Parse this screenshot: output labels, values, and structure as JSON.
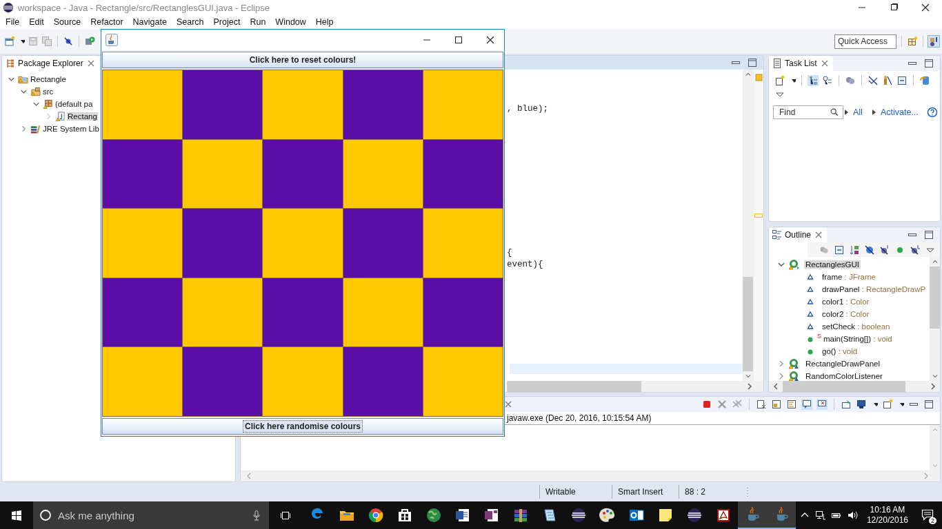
{
  "window": {
    "title": "workspace - Java - Rectangle/src/RectanglesGUI.java - Eclipse"
  },
  "menu": [
    "File",
    "Edit",
    "Source",
    "Refactor",
    "Navigate",
    "Search",
    "Project",
    "Run",
    "Window",
    "Help"
  ],
  "quick_access": {
    "placeholder": "Quick Access"
  },
  "package_explorer": {
    "title": "Package Explorer",
    "tree": [
      {
        "kind": "project",
        "label": "Rectangle",
        "expanded": true,
        "selected": false,
        "children": [
          {
            "kind": "folder",
            "label": "src",
            "expanded": true,
            "selected": false,
            "children": [
              {
                "kind": "package",
                "label": "(default pa",
                "expanded": true,
                "selected": false,
                "children": [
                  {
                    "kind": "file",
                    "label": "Rectang",
                    "expanded": false,
                    "selected": true
                  }
                ]
              }
            ]
          },
          {
            "kind": "library",
            "label": "JRE System Lib",
            "expanded": false,
            "selected": false
          }
        ]
      }
    ]
  },
  "editor": {
    "lines": [
      ", blue);",
      "{",
      "event){"
    ]
  },
  "task_list": {
    "title": "Task List",
    "find": {
      "placeholder": "Find"
    },
    "links": [
      "All",
      "Activate..."
    ]
  },
  "outline": {
    "title": "Outline",
    "tree": [
      {
        "kind": "class",
        "name": "RectanglesGUI",
        "expanded": true,
        "selected": true,
        "children": [
          {
            "kind": "field",
            "name": "frame",
            "type": ": JFrame"
          },
          {
            "kind": "field",
            "name": "drawPanel",
            "type": ": RectangleDrawP"
          },
          {
            "kind": "field",
            "name": "color1",
            "type": ": Color"
          },
          {
            "kind": "field",
            "name": "color2",
            "type": ": Color"
          },
          {
            "kind": "field",
            "name": "setCheck",
            "type": ": boolean"
          },
          {
            "kind": "method",
            "name": "main(String[])",
            "type": ": void",
            "badge": "S"
          },
          {
            "kind": "method",
            "name": "go()",
            "type": ": void"
          }
        ]
      },
      {
        "kind": "inner",
        "name": "RectangleDrawPanel",
        "expanded": false,
        "selected": false
      },
      {
        "kind": "inner",
        "name": "RandomColorListener",
        "expanded": false,
        "selected": false
      }
    ]
  },
  "console": {
    "process": "javaw.exe (Dec 20, 2016, 10:15:54 AM)"
  },
  "status_bar": [
    "Writable",
    "Smart Insert",
    "88 : 2"
  ],
  "java_window": {
    "buttons": [
      {
        "label": "Click here to reset colours!",
        "focused": false
      },
      {
        "label": "Click here randomise colours",
        "focused": true
      }
    ],
    "grid": [
      [
        {
          "color": "#ffc800"
        },
        {
          "color": "#5a0ea5"
        },
        {
          "color": "#ffc800"
        },
        {
          "color": "#5a0ea5"
        },
        {
          "color": "#ffc800"
        }
      ],
      [
        {
          "color": "#5a0ea5"
        },
        {
          "color": "#ffc800"
        },
        {
          "color": "#5a0ea5"
        },
        {
          "color": "#ffc800"
        },
        {
          "color": "#5a0ea5"
        }
      ],
      [
        {
          "color": "#ffc800"
        },
        {
          "color": "#5a0ea5"
        },
        {
          "color": "#ffc800"
        },
        {
          "color": "#5a0ea5"
        },
        {
          "color": "#ffc800"
        }
      ],
      [
        {
          "color": "#5a0ea5"
        },
        {
          "color": "#ffc800"
        },
        {
          "color": "#5a0ea5"
        },
        {
          "color": "#ffc800"
        },
        {
          "color": "#5a0ea5"
        }
      ],
      [
        {
          "color": "#ffc800"
        },
        {
          "color": "#5a0ea5"
        },
        {
          "color": "#ffc800"
        },
        {
          "color": "#5a0ea5"
        },
        {
          "color": "#ffc800"
        }
      ]
    ]
  },
  "taskbar": {
    "search": {
      "placeholder": "Ask me anything"
    },
    "apps": [
      {
        "kind": "edge",
        "selected": false
      },
      {
        "kind": "folder",
        "selected": false
      },
      {
        "kind": "chrome",
        "selected": false
      },
      {
        "kind": "store",
        "selected": false
      },
      {
        "kind": "globe",
        "selected": false
      },
      {
        "kind": "word",
        "selected": false
      },
      {
        "kind": "onenote",
        "selected": false
      },
      {
        "kind": "books",
        "selected": false
      },
      {
        "kind": "notepad",
        "selected": false
      },
      {
        "kind": "eclipse",
        "selected": false
      },
      {
        "kind": "paint",
        "selected": false
      },
      {
        "kind": "outlook",
        "selected": false
      },
      {
        "kind": "sticky",
        "selected": false
      },
      {
        "kind": "eclipse",
        "selected": false
      },
      {
        "kind": "acrobat",
        "selected": false
      },
      {
        "kind": "java",
        "selected": true
      },
      {
        "kind": "java",
        "selected": true
      }
    ],
    "clock": {
      "time": "10:16 AM",
      "date": "12/20/2016"
    },
    "notifications": "2"
  }
}
